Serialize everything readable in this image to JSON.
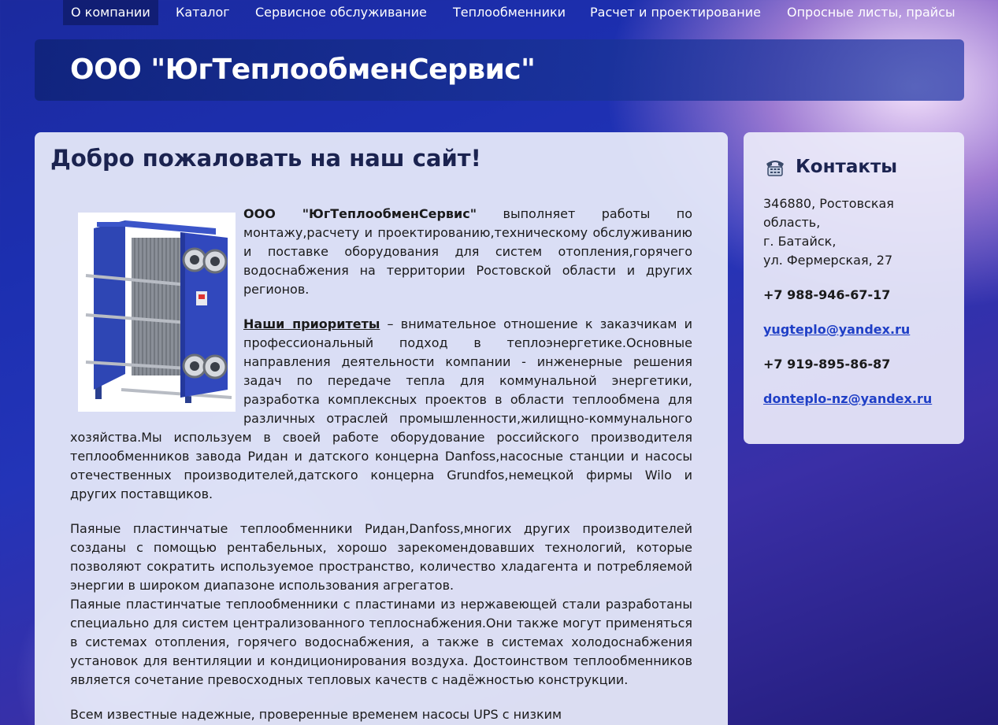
{
  "nav": {
    "items": [
      {
        "label": "О компании",
        "active": true
      },
      {
        "label": "Каталог"
      },
      {
        "label": "Сервисное обслуживание"
      },
      {
        "label": "Теплообменники"
      },
      {
        "label": "Расчет и проектирование"
      },
      {
        "label": "Опросные листы, прайсы"
      }
    ]
  },
  "header": {
    "title": "ООО \"ЮгТеплообменСервис\""
  },
  "main": {
    "heading": "Добро пожаловать на наш сайт!",
    "p1_company": "ООО \"ЮгТеплообменСервис\"",
    "p1_text": " выполняет работы по монтажу,расчету и проектированию,техническому обслуживанию и поставке оборудования для систем отопления,горячего водоснабжения на территории Ростовской области и других регионов.",
    "p2_link": "Наши приоритеты",
    "p2_text": " – внимательное отношение к заказчикам и профессиональный подход в теплоэнергетике.Основные направления деятельности компании - инженерные решения задач по передаче тепла для коммунальной энергетики, разработка комплексных проектов в области теплообмена для различных отраслей промышленности,жилищно-коммунального хозяйства.Мы используем в своей работе оборудование российского производителя теплообменников завода Ридан и датского концерна Danfoss,насосные станции и насосы отечественных производителей,датского концерна Grundfos,немецкой фирмы Wilo и других поставщиков.",
    "p3_line1": "Паяные пластинчатые теплообменники Ридан,Danfoss,многих других производителей созданы с помощью рентабельных, хорошо зарекомендовавших технологий, которые позволяют сократить используемое пространство, количество хладагента и потребляемой энергии в широком диапазоне использования агрегатов.",
    "p3_line2": "Паяные пластинчатые теплообменники с пластинами из нержавеющей стали разработаны специально для систем централизованного теплоснабжения.Они также могут применяться в системах отопления, горячего водоснабжения, а также в системах холодоснабжения установок для вентиляции и кондиционирования воздуха. Достоинством теплообменников является сочетание превосходных тепловых качеств с надёжностью конструкции.",
    "p4_text": "Всем известные надежные, проверенные временем насосы UPS с низким"
  },
  "sidebar": {
    "title": "Контакты",
    "address": [
      "346880, Ростовская область,",
      "г. Батайск,",
      "ул. Фермерская, 27"
    ],
    "phone1": "+7 988-946-67-17",
    "email1": "yugteplo@yandex.ru",
    "phone2": "+7 919-895-86-87",
    "email2": "donteplo-nz@yandex.ru"
  },
  "colors": {
    "heading": "#1b2350",
    "link": "#1f3fc6",
    "nav_active_bg": "#0a1450"
  },
  "icons": {
    "contacts": "telephone-icon",
    "product": "plate-heat-exchanger-photo"
  }
}
